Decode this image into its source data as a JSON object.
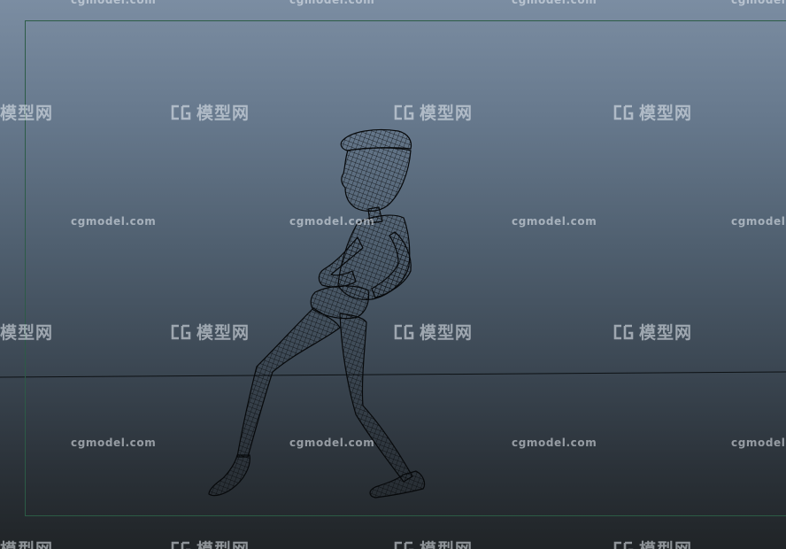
{
  "viewport": {
    "background_top": "#7b8da2",
    "background_bottom": "#202427",
    "gate_color": "#2c5b46",
    "wire_color": "#0a0c0e"
  },
  "watermarks": {
    "url_text": "cgmodel.com",
    "cn_text": "模型网",
    "logo_icon": "cg-logo-icon"
  },
  "model": {
    "icon": "wireframe-character"
  }
}
